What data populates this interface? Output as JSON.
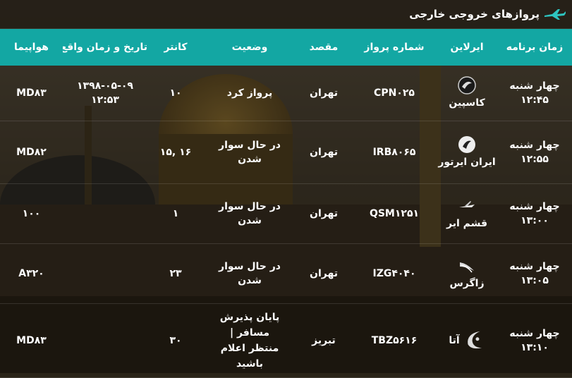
{
  "header": {
    "title": "پروازهای خروجی خارجی",
    "icon": "airplane-icon"
  },
  "columns": [
    "زمان برنامه",
    "ایرلاین",
    "شماره پرواز",
    "مقصد",
    "وضعیت",
    "کانتر",
    "تاریخ و زمان واقع",
    "هواپیما"
  ],
  "rows": [
    {
      "sched_day": "چهار شنبه",
      "sched_time": "۱۲:۴۵",
      "airline": "کاسپین",
      "airline_icon": "caspian-logo-icon",
      "flight": "CPN۰۲۵",
      "dest": "تهران",
      "status": "پرواز کرد",
      "counter": "۱۰",
      "actual_date": "۱۳۹۸-۰۵-۰۹",
      "actual_time": "۱۲:۵۳",
      "aircraft": "MD۸۳"
    },
    {
      "sched_day": "چهار شنبه",
      "sched_time": "۱۲:۵۵",
      "airline": "ایران ایرتور",
      "airline_icon": "iran-airtour-logo-icon",
      "flight": "IRB۸۰۶۵",
      "dest": "تهران",
      "status": "در حال سوار شدن",
      "counter": "۱۶ ,۱۵",
      "actual_date": "",
      "actual_time": "",
      "aircraft": "MD۸۲"
    },
    {
      "sched_day": "چهار شنبه",
      "sched_time": "۱۳:۰۰",
      "airline": "قشم ایر",
      "airline_icon": "qeshm-air-logo-icon",
      "flight": "QSM۱۲۵۱",
      "dest": "تهران",
      "status": "در حال سوار شدن",
      "counter": "۱",
      "actual_date": "",
      "actual_time": "",
      "aircraft": "۱۰۰"
    },
    {
      "sched_day": "چهار شنبه",
      "sched_time": "۱۳:۰۵",
      "airline": "زاگرس",
      "airline_icon": "zagros-logo-icon",
      "flight": "IZG۴۰۴۰",
      "dest": "تهران",
      "status": "در حال سوار شدن",
      "counter": "۲۳",
      "actual_date": "",
      "actual_time": "",
      "aircraft": "A۳۲۰"
    },
    {
      "sched_day": "چهار شنبه",
      "sched_time": "۱۳:۱۰",
      "airline": "آتا",
      "airline_icon": "ata-logo-icon",
      "flight": "TBZ۵۶۱۶",
      "dest": "تبریز",
      "status": "پایان پذیرش مسافر | منتظر اعلام باشید",
      "counter": "۳۰",
      "actual_date": "",
      "actual_time": "",
      "aircraft": "MD۸۳"
    }
  ],
  "colors": {
    "header_bg": "#13a7a3",
    "icon_accent": "#2ec4c0"
  }
}
